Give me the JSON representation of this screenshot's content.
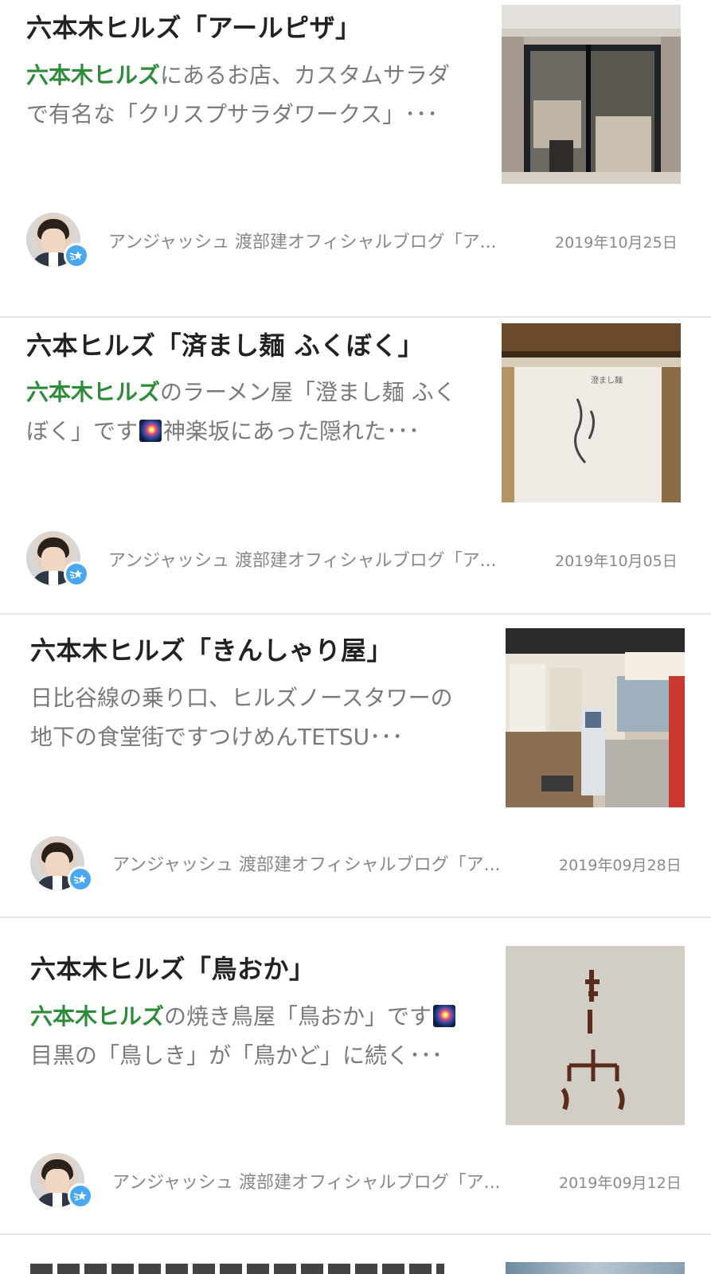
{
  "articles": [
    {
      "title": "六本木ヒルズ「アールピザ」",
      "desc_keyword": "六本木ヒルズ",
      "desc_rest": "にあるお店、カスタムサラダで有名な「クリスプサラダワークス」･･･",
      "blog_name": "アンジャッシュ 渡部建オフィシャルブログ「ア...",
      "date": "2019年10月25日"
    },
    {
      "title": "六本ヒルズ「済まし麺 ふくぼく」",
      "desc_keyword": "六本木ヒルズ",
      "desc_rest": "のラーメン屋「澄まし麺 ふくぼく」です",
      "desc_rest2": "神楽坂にあった隠れた･･･",
      "blog_name": "アンジャッシュ 渡部建オフィシャルブログ「ア...",
      "date": "2019年10月05日"
    },
    {
      "title": "六本木ヒルズ「きんしゃり屋」",
      "desc_plain": "日比谷線の乗り口、ヒルズノースタワーの地下の食堂街ですつけめんTETSU･･･",
      "blog_name": "アンジャッシュ 渡部建オフィシャルブログ「ア...",
      "date": "2019年09月28日"
    },
    {
      "title": "六本木ヒルズ「鳥おか」",
      "desc_keyword": "六本木ヒルズ",
      "desc_rest": "の焼き鳥屋「鳥おか」です",
      "desc_rest2": "目黒の「鳥しき」が「鳥かど」に続く･･･",
      "blog_name": "アンジャッシュ 渡部建オフィシャルブログ「ア...",
      "date": "2019年09月12日"
    }
  ],
  "icons": {
    "avatar": "author-avatar",
    "badge": "shooting-star-badge-icon",
    "emoji": "sparkle-firework-emoji"
  },
  "colors": {
    "keyword": "#2e8b3a",
    "badge": "#4aa8ee"
  }
}
